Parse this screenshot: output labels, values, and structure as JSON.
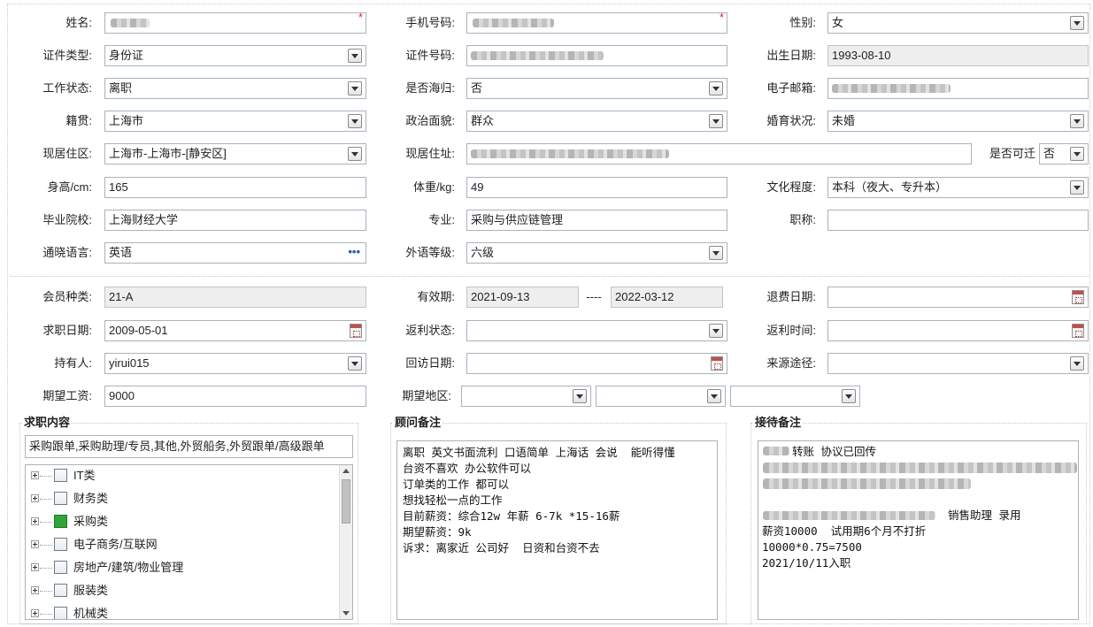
{
  "basic": {
    "name_label": "姓名:",
    "phone_label": "手机号码:",
    "gender_label": "性别:",
    "gender_value": "女",
    "id_type_label": "证件类型:",
    "id_type_value": "身份证",
    "id_no_label": "证件号码:",
    "birth_label": "出生日期:",
    "birth_value": "1993-08-10",
    "work_status_label": "工作状态:",
    "work_status_value": "离职",
    "overseas_label": "是否海归:",
    "overseas_value": "否",
    "email_label": "电子邮箱:",
    "native_label": "籍贯:",
    "native_value": "上海市",
    "political_label": "政治面貌:",
    "political_value": "群众",
    "marital_label": "婚育状况:",
    "marital_value": "未婚",
    "area_label": "现居住区:",
    "area_value": "上海市-上海市-[静安区]",
    "address_label": "现居住址:",
    "relocate_label": "是否可迁",
    "relocate_value": "否",
    "height_label": "身高/cm:",
    "height_value": "165",
    "weight_label": "体重/kg:",
    "weight_value": "49",
    "edu_label": "文化程度:",
    "edu_value": "本科（夜大、专升本）",
    "school_label": "毕业院校:",
    "school_value": "上海财经大学",
    "major_label": "专业:",
    "major_value": "采购与供应链管理",
    "title_label": "职称:",
    "title_value": "",
    "language_label": "通晓语言:",
    "language_value": "英语",
    "lang_level_label": "外语等级:",
    "lang_level_value": "六级",
    "required_mark": "*",
    "dots": "•••"
  },
  "member": {
    "type_label": "会员种类:",
    "type_value": "21-A",
    "valid_label": "有效期:",
    "valid_from": "2021-09-13",
    "valid_sep": "----",
    "valid_to": "2022-03-12",
    "refund_date_label": "退费日期:",
    "refund_date_value": "",
    "apply_date_label": "求职日期:",
    "apply_date_value": "2009-05-01",
    "rebate_status_label": "返利状态:",
    "rebate_status_value": "",
    "rebate_time_label": "返利时间:",
    "rebate_time_value": "",
    "holder_label": "持有人:",
    "holder_value": "yirui015",
    "visit_date_label": "回访日期:",
    "visit_date_value": "",
    "source_label": "来源途径:",
    "source_value": "",
    "salary_label": "期望工资:",
    "salary_value": "9000",
    "region_label": "期望地区:"
  },
  "job": {
    "title": "求职内容",
    "summary": "采购跟单,采购助理/专员,其他,外贸船务,外贸跟单/高级跟单",
    "tree": [
      {
        "label": "IT类",
        "checked": false
      },
      {
        "label": "财务类",
        "checked": false
      },
      {
        "label": "采购类",
        "checked": true
      },
      {
        "label": "电子商务/互联网",
        "checked": false
      },
      {
        "label": "房地产/建筑/物业管理",
        "checked": false
      },
      {
        "label": "服装类",
        "checked": false
      },
      {
        "label": "机械类",
        "checked": false
      }
    ]
  },
  "consultant": {
    "title": "顾问备注",
    "notes": "离职 英文书面流利 口语简单 上海话 会说  能听得懂\n台资不喜欢 办公软件可以\n订单类的工作 都可以\n想找轻松一点的工作\n目前薪资：综合12w 年薪 6-7k *15-16薪\n期望薪资：9k\n诉求：离家近 公司好  日资和台资不去"
  },
  "reception": {
    "title": "接待备注",
    "line1": "转账 协议已回传",
    "line4": "销售助理 录用",
    "line5": "薪资10000  试用期6个月不打折",
    "line6": "10000*0.75=7500",
    "line7": "2021/10/11入职"
  }
}
